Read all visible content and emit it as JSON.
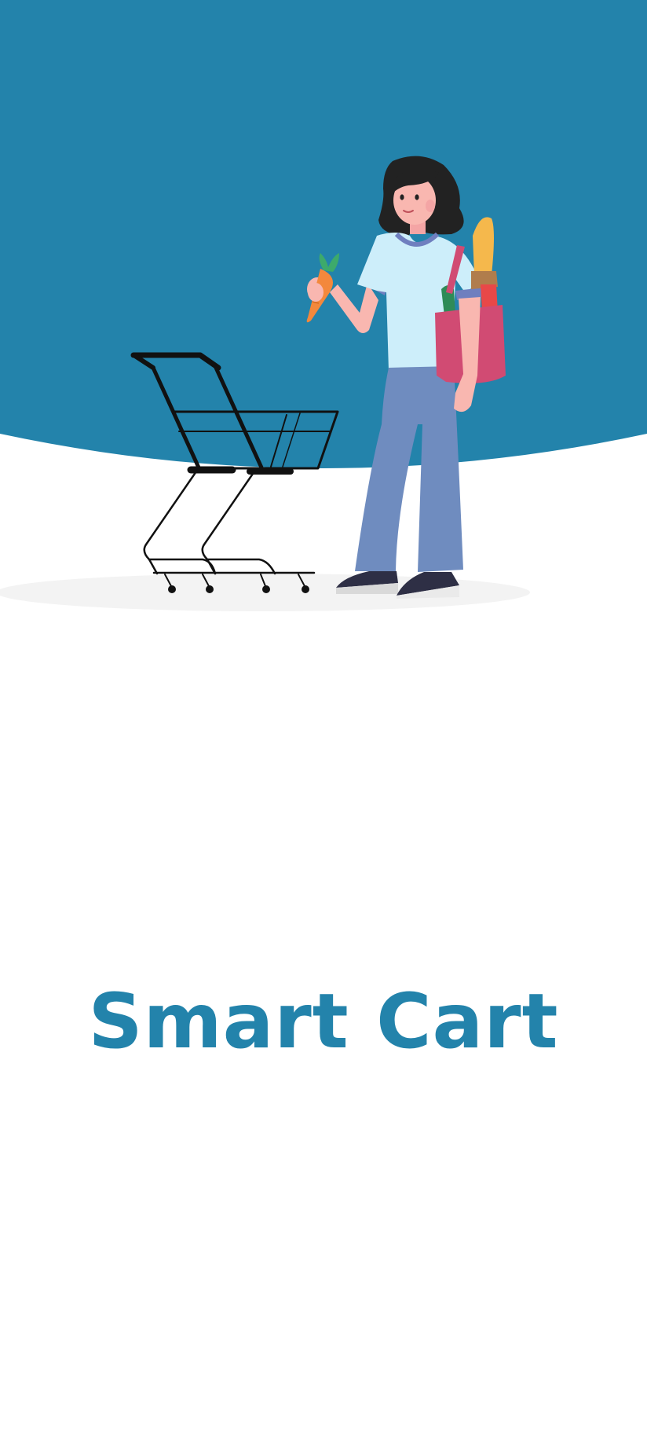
{
  "app": {
    "title": "Smart Cart"
  },
  "colors": {
    "brand": "#2383AB",
    "background": "#FFFFFF",
    "ground_shadow": "#F3F3F3"
  },
  "illustration": {
    "icons": [
      "shopping-cart-icon",
      "woman-shopper-illustration",
      "carrot-icon",
      "grocery-bag-icon",
      "baguette-icon"
    ]
  }
}
